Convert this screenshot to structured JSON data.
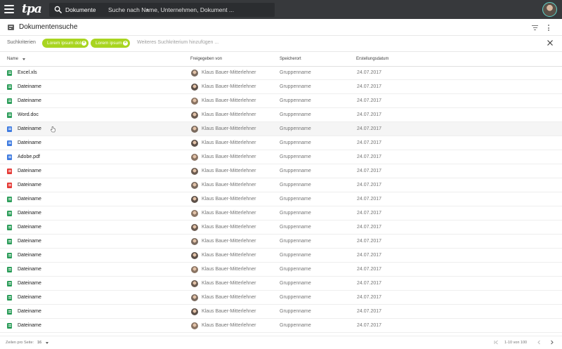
{
  "topbar": {
    "logo": "tpa",
    "search_scope": "Dokumente",
    "search_placeholder": "Suche nach Name, Unternehmen, Dokument ..."
  },
  "page": {
    "title": "Dokumentensuche"
  },
  "criteria": {
    "label": "Suchkriterien",
    "chips": [
      "Lorem ipsum dol",
      "Lorem ipsum"
    ],
    "input_placeholder": "Weiteres Suchkriterium hinzufügen ..."
  },
  "table": {
    "columns": [
      "Name",
      "Freigegeben von",
      "Speicherort",
      "Erstellungsdatum"
    ],
    "rows": [
      {
        "type": "sheet",
        "name": "Excel.xls",
        "user": "Klaus Bauer-Mitterlehner",
        "location": "Gruppenname",
        "date": "24.07.2017"
      },
      {
        "type": "sheet",
        "name": "Dateiname",
        "user": "Klaus Bauer-Mitterlehner",
        "location": "Gruppenname",
        "date": "24.07.2017"
      },
      {
        "type": "sheet",
        "name": "Dateiname",
        "user": "Klaus Bauer-Mitterlehner",
        "location": "Gruppenname",
        "date": "24.07.2017"
      },
      {
        "type": "sheet",
        "name": "Word.doc",
        "user": "Klaus Bauer-Mitterlehner",
        "location": "Gruppenname",
        "date": "24.07.2017"
      },
      {
        "type": "doc",
        "name": "Dateiname",
        "user": "Klaus Bauer-Mitterlehner",
        "location": "Gruppenname",
        "date": "24.07.2017"
      },
      {
        "type": "doc",
        "name": "Dateiname",
        "user": "Klaus Bauer-Mitterlehner",
        "location": "Gruppenname",
        "date": "24.07.2017"
      },
      {
        "type": "doc",
        "name": "Adobe.pdf",
        "user": "Klaus Bauer-Mitterlehner",
        "location": "Gruppenname",
        "date": "24.07.2017"
      },
      {
        "type": "pdf",
        "name": "Dateiname",
        "user": "Klaus Bauer-Mitterlehner",
        "location": "Gruppenname",
        "date": "24.07.2017"
      },
      {
        "type": "pdf",
        "name": "Dateiname",
        "user": "Klaus Bauer-Mitterlehner",
        "location": "Gruppenname",
        "date": "24.07.2017"
      },
      {
        "type": "sheet",
        "name": "Dateiname",
        "user": "Klaus Bauer-Mitterlehner",
        "location": "Gruppenname",
        "date": "24.07.2017"
      },
      {
        "type": "sheet",
        "name": "Dateiname",
        "user": "Klaus Bauer-Mitterlehner",
        "location": "Gruppenname",
        "date": "24.07.2017"
      },
      {
        "type": "sheet",
        "name": "Dateiname",
        "user": "Klaus Bauer-Mitterlehner",
        "location": "Gruppenname",
        "date": "24.07.2017"
      },
      {
        "type": "sheet",
        "name": "Dateiname",
        "user": "Klaus Bauer-Mitterlehner",
        "location": "Gruppenname",
        "date": "24.07.2017"
      },
      {
        "type": "sheet",
        "name": "Dateiname",
        "user": "Klaus Bauer-Mitterlehner",
        "location": "Gruppenname",
        "date": "24.07.2017"
      },
      {
        "type": "sheet",
        "name": "Dateiname",
        "user": "Klaus Bauer-Mitterlehner",
        "location": "Gruppenname",
        "date": "24.07.2017"
      },
      {
        "type": "sheet",
        "name": "Dateiname",
        "user": "Klaus Bauer-Mitterlehner",
        "location": "Gruppenname",
        "date": "24.07.2017"
      },
      {
        "type": "sheet",
        "name": "Dateiname",
        "user": "Klaus Bauer-Mitterlehner",
        "location": "Gruppenname",
        "date": "24.07.2017"
      },
      {
        "type": "sheet",
        "name": "Dateiname",
        "user": "Klaus Bauer-Mitterlehner",
        "location": "Gruppenname",
        "date": "24.07.2017"
      },
      {
        "type": "sheet",
        "name": "Dateiname",
        "user": "Klaus Bauer-Mitterlehner",
        "location": "Gruppenname",
        "date": "24.07.2017"
      }
    ]
  },
  "footer": {
    "rows_per_page_label": "Zeilen pro Seite:",
    "rows_per_page_value": "16",
    "range": "1-10 von 100"
  },
  "colors": {
    "topbar": "#37393c",
    "chip": "#a8d520",
    "sheet_icon": "#2e9e5b",
    "doc_icon": "#3f7be0",
    "pdf_icon": "#e53935"
  }
}
